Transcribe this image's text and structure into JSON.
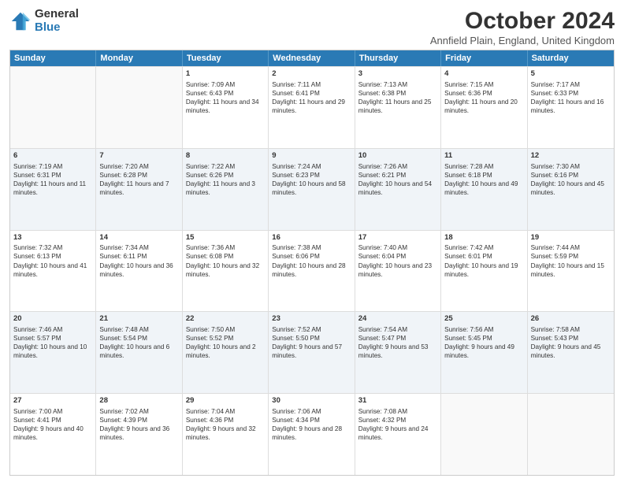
{
  "header": {
    "logo_general": "General",
    "logo_blue": "Blue",
    "title": "October 2024",
    "location": "Annfield Plain, England, United Kingdom"
  },
  "weekdays": [
    "Sunday",
    "Monday",
    "Tuesday",
    "Wednesday",
    "Thursday",
    "Friday",
    "Saturday"
  ],
  "rows": [
    [
      {
        "day": "",
        "sunrise": "",
        "sunset": "",
        "daylight": "",
        "empty": true
      },
      {
        "day": "",
        "sunrise": "",
        "sunset": "",
        "daylight": "",
        "empty": true
      },
      {
        "day": "1",
        "sunrise": "Sunrise: 7:09 AM",
        "sunset": "Sunset: 6:43 PM",
        "daylight": "Daylight: 11 hours and 34 minutes."
      },
      {
        "day": "2",
        "sunrise": "Sunrise: 7:11 AM",
        "sunset": "Sunset: 6:41 PM",
        "daylight": "Daylight: 11 hours and 29 minutes."
      },
      {
        "day": "3",
        "sunrise": "Sunrise: 7:13 AM",
        "sunset": "Sunset: 6:38 PM",
        "daylight": "Daylight: 11 hours and 25 minutes."
      },
      {
        "day": "4",
        "sunrise": "Sunrise: 7:15 AM",
        "sunset": "Sunset: 6:36 PM",
        "daylight": "Daylight: 11 hours and 20 minutes."
      },
      {
        "day": "5",
        "sunrise": "Sunrise: 7:17 AM",
        "sunset": "Sunset: 6:33 PM",
        "daylight": "Daylight: 11 hours and 16 minutes."
      }
    ],
    [
      {
        "day": "6",
        "sunrise": "Sunrise: 7:19 AM",
        "sunset": "Sunset: 6:31 PM",
        "daylight": "Daylight: 11 hours and 11 minutes."
      },
      {
        "day": "7",
        "sunrise": "Sunrise: 7:20 AM",
        "sunset": "Sunset: 6:28 PM",
        "daylight": "Daylight: 11 hours and 7 minutes."
      },
      {
        "day": "8",
        "sunrise": "Sunrise: 7:22 AM",
        "sunset": "Sunset: 6:26 PM",
        "daylight": "Daylight: 11 hours and 3 minutes."
      },
      {
        "day": "9",
        "sunrise": "Sunrise: 7:24 AM",
        "sunset": "Sunset: 6:23 PM",
        "daylight": "Daylight: 10 hours and 58 minutes."
      },
      {
        "day": "10",
        "sunrise": "Sunrise: 7:26 AM",
        "sunset": "Sunset: 6:21 PM",
        "daylight": "Daylight: 10 hours and 54 minutes."
      },
      {
        "day": "11",
        "sunrise": "Sunrise: 7:28 AM",
        "sunset": "Sunset: 6:18 PM",
        "daylight": "Daylight: 10 hours and 49 minutes."
      },
      {
        "day": "12",
        "sunrise": "Sunrise: 7:30 AM",
        "sunset": "Sunset: 6:16 PM",
        "daylight": "Daylight: 10 hours and 45 minutes."
      }
    ],
    [
      {
        "day": "13",
        "sunrise": "Sunrise: 7:32 AM",
        "sunset": "Sunset: 6:13 PM",
        "daylight": "Daylight: 10 hours and 41 minutes."
      },
      {
        "day": "14",
        "sunrise": "Sunrise: 7:34 AM",
        "sunset": "Sunset: 6:11 PM",
        "daylight": "Daylight: 10 hours and 36 minutes."
      },
      {
        "day": "15",
        "sunrise": "Sunrise: 7:36 AM",
        "sunset": "Sunset: 6:08 PM",
        "daylight": "Daylight: 10 hours and 32 minutes."
      },
      {
        "day": "16",
        "sunrise": "Sunrise: 7:38 AM",
        "sunset": "Sunset: 6:06 PM",
        "daylight": "Daylight: 10 hours and 28 minutes."
      },
      {
        "day": "17",
        "sunrise": "Sunrise: 7:40 AM",
        "sunset": "Sunset: 6:04 PM",
        "daylight": "Daylight: 10 hours and 23 minutes."
      },
      {
        "day": "18",
        "sunrise": "Sunrise: 7:42 AM",
        "sunset": "Sunset: 6:01 PM",
        "daylight": "Daylight: 10 hours and 19 minutes."
      },
      {
        "day": "19",
        "sunrise": "Sunrise: 7:44 AM",
        "sunset": "Sunset: 5:59 PM",
        "daylight": "Daylight: 10 hours and 15 minutes."
      }
    ],
    [
      {
        "day": "20",
        "sunrise": "Sunrise: 7:46 AM",
        "sunset": "Sunset: 5:57 PM",
        "daylight": "Daylight: 10 hours and 10 minutes."
      },
      {
        "day": "21",
        "sunrise": "Sunrise: 7:48 AM",
        "sunset": "Sunset: 5:54 PM",
        "daylight": "Daylight: 10 hours and 6 minutes."
      },
      {
        "day": "22",
        "sunrise": "Sunrise: 7:50 AM",
        "sunset": "Sunset: 5:52 PM",
        "daylight": "Daylight: 10 hours and 2 minutes."
      },
      {
        "day": "23",
        "sunrise": "Sunrise: 7:52 AM",
        "sunset": "Sunset: 5:50 PM",
        "daylight": "Daylight: 9 hours and 57 minutes."
      },
      {
        "day": "24",
        "sunrise": "Sunrise: 7:54 AM",
        "sunset": "Sunset: 5:47 PM",
        "daylight": "Daylight: 9 hours and 53 minutes."
      },
      {
        "day": "25",
        "sunrise": "Sunrise: 7:56 AM",
        "sunset": "Sunset: 5:45 PM",
        "daylight": "Daylight: 9 hours and 49 minutes."
      },
      {
        "day": "26",
        "sunrise": "Sunrise: 7:58 AM",
        "sunset": "Sunset: 5:43 PM",
        "daylight": "Daylight: 9 hours and 45 minutes."
      }
    ],
    [
      {
        "day": "27",
        "sunrise": "Sunrise: 7:00 AM",
        "sunset": "Sunset: 4:41 PM",
        "daylight": "Daylight: 9 hours and 40 minutes."
      },
      {
        "day": "28",
        "sunrise": "Sunrise: 7:02 AM",
        "sunset": "Sunset: 4:39 PM",
        "daylight": "Daylight: 9 hours and 36 minutes."
      },
      {
        "day": "29",
        "sunrise": "Sunrise: 7:04 AM",
        "sunset": "Sunset: 4:36 PM",
        "daylight": "Daylight: 9 hours and 32 minutes."
      },
      {
        "day": "30",
        "sunrise": "Sunrise: 7:06 AM",
        "sunset": "Sunset: 4:34 PM",
        "daylight": "Daylight: 9 hours and 28 minutes."
      },
      {
        "day": "31",
        "sunrise": "Sunrise: 7:08 AM",
        "sunset": "Sunset: 4:32 PM",
        "daylight": "Daylight: 9 hours and 24 minutes."
      },
      {
        "day": "",
        "sunrise": "",
        "sunset": "",
        "daylight": "",
        "empty": true
      },
      {
        "day": "",
        "sunrise": "",
        "sunset": "",
        "daylight": "",
        "empty": true
      }
    ]
  ]
}
